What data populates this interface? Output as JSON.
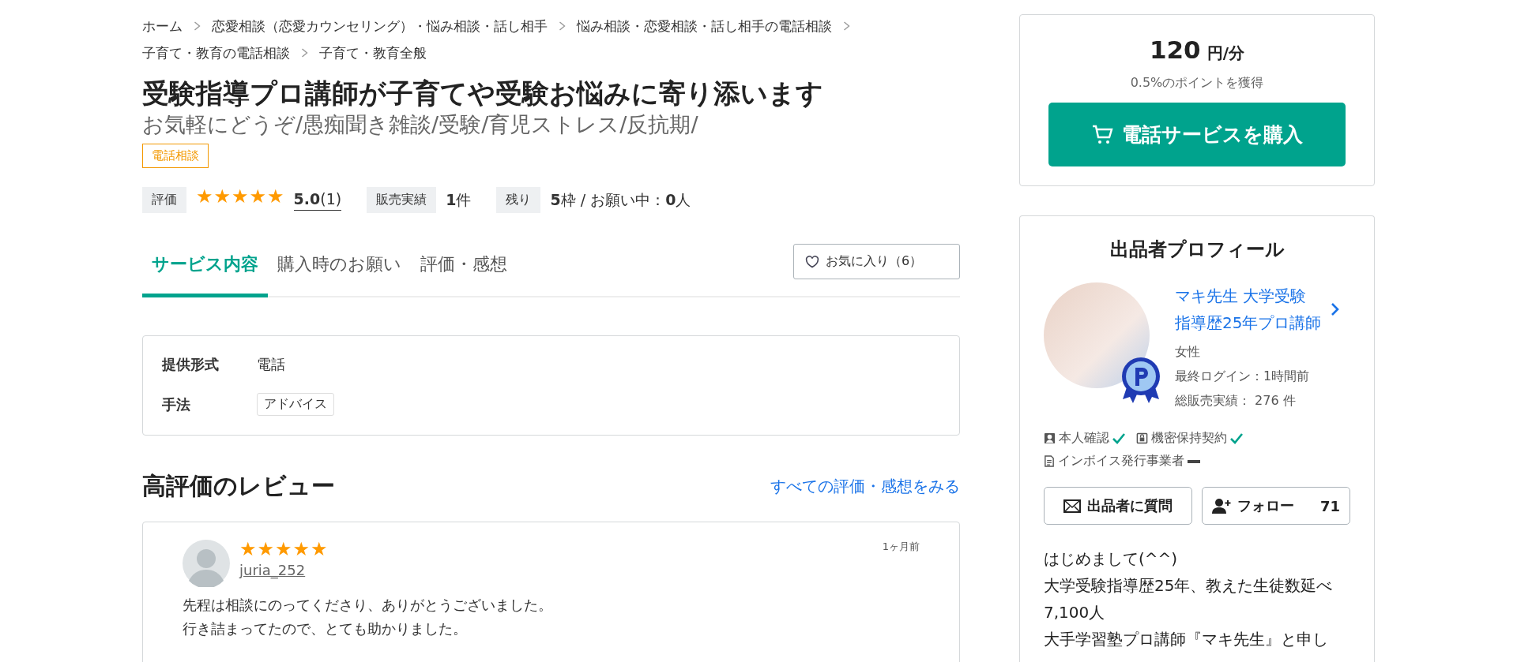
{
  "breadcrumbs": [
    "ホーム",
    "恋愛相談（恋愛カウンセリング）・悩み相談・話し相手",
    "悩み相談・恋愛相談・話し相手の電話相談",
    "子育て・教育の電話相談",
    "子育て・教育全般"
  ],
  "title": "受験指導プロ講師が子育てや受験お悩みに寄り添います",
  "subtitle": "お気軽にどうぞ/愚痴聞き雑談/受験/育児ストレス/反抗期/",
  "category_tag": "電話相談",
  "stats": {
    "rating_label": "評価",
    "stars": 5,
    "rating": "5.0",
    "rating_count": "(1)",
    "sales_label": "販売実績",
    "sales_value": "1",
    "sales_unit": "件",
    "remaining_label": "残り",
    "remaining_value": "5",
    "remaining_unit": "枠 / お願い中：",
    "requests_value": "0",
    "requests_unit": "人"
  },
  "tabs": [
    {
      "label": "サービス内容",
      "selected": true
    },
    {
      "label": "購入時のお願い",
      "selected": false
    },
    {
      "label": "評価・感想",
      "selected": false
    }
  ],
  "favorite_button": "お気に入り（6）",
  "details": [
    {
      "label": "提供形式",
      "value": "電話",
      "kind": "text"
    },
    {
      "label": "手法",
      "value": "アドバイス",
      "kind": "tag"
    }
  ],
  "reviews_section": {
    "heading": "高評価のレビュー",
    "link": "すべての評価・感想をみる",
    "reviews": [
      {
        "stars": 5,
        "user": "juria_252",
        "time": "1ヶ月前",
        "lines": [
          "先程は相談にのってくださり、ありがとうございました。",
          "行き詰まってたので、とても助かりました。"
        ]
      }
    ]
  },
  "purchase": {
    "price": "120",
    "unit": "円/分",
    "points": "0.5%のポイントを獲得",
    "button": "電話サービスを購入"
  },
  "profile": {
    "heading": "出品者プロフィール",
    "name_lines": [
      "マキ先生 大学受験",
      "指導歴25年プロ講師"
    ],
    "gender": "女性",
    "last_login": "最終ログイン：1時間前",
    "total_sales": "総販売実績： 276 件",
    "badges": [
      {
        "label": "本人確認",
        "kind": "person",
        "checked": true
      },
      {
        "label": "機密保持契約",
        "kind": "lock",
        "checked": true
      },
      {
        "label": "インボイス発行事業者",
        "kind": "document",
        "checked": false
      }
    ],
    "ask_button": "出品者に質問",
    "follow_button": "フォロー",
    "follow_count": "71",
    "bio_lines": [
      "はじめまして(^^)",
      "大学受験指導歴25年、教えた生徒数延べ",
      "7,100人",
      "大手学習塾プロ講師『マキ先生』と申し"
    ]
  }
}
